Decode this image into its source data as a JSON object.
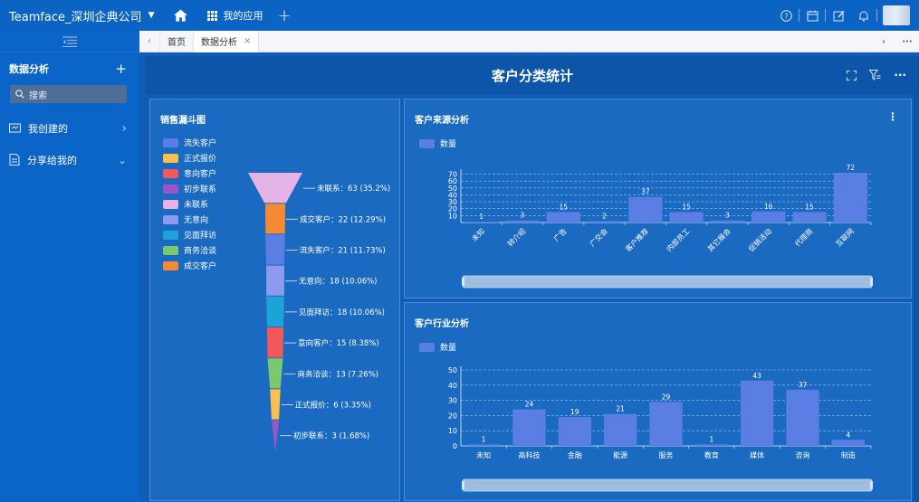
{
  "topbar": {
    "company": "Teamface_深圳企典公司",
    "apps_label": "我的应用"
  },
  "sidebar": {
    "title": "数据分析",
    "search_placeholder": "搜索",
    "items": [
      {
        "label": "我创建的",
        "icon": "folder-icon",
        "chevron": "›"
      },
      {
        "label": "分享给我的",
        "icon": "share-doc-icon",
        "chevron": "⌄"
      }
    ]
  },
  "tabs": [
    {
      "label": "首页",
      "active": false
    },
    {
      "label": "数据分析",
      "active": true,
      "closable": true
    }
  ],
  "dashboard": {
    "title": "客户分类统计"
  },
  "funnel": {
    "title": "销售漏斗图",
    "legend": [
      {
        "label": "流失客户",
        "color": "#5b7ee5"
      },
      {
        "label": "正式报价",
        "color": "#f8c04f"
      },
      {
        "label": "意向客户",
        "color": "#f25a5a"
      },
      {
        "label": "初步联系",
        "color": "#9a55c9"
      },
      {
        "label": "未联系",
        "color": "#e6b3e6"
      },
      {
        "label": "无意向",
        "color": "#8c9af0"
      },
      {
        "label": "见面拜访",
        "color": "#1ea3d6"
      },
      {
        "label": "商务洽谈",
        "color": "#7bc96f"
      },
      {
        "label": "成交客户",
        "color": "#f58a33"
      }
    ]
  },
  "chart_data": [
    {
      "type": "funnel",
      "title": "销售漏斗图",
      "stages": [
        {
          "name": "未联系",
          "value": 63,
          "percent": "35.2%",
          "label": "未联系：63 (35.2%)",
          "color": "#e6b3e6"
        },
        {
          "name": "成交客户",
          "value": 22,
          "percent": "12.29%",
          "label": "成交客户：22 (12.29%)",
          "color": "#f58a33"
        },
        {
          "name": "流失客户",
          "value": 21,
          "percent": "11.73%",
          "label": "流失客户：21 (11.73%)",
          "color": "#5b7ee5"
        },
        {
          "name": "无意向",
          "value": 18,
          "percent": "10.06%",
          "label": "无意向：18 (10.06%)",
          "color": "#8c9af0"
        },
        {
          "name": "见面拜访",
          "value": 18,
          "percent": "10.06%",
          "label": "见面拜访：18 (10.06%)",
          "color": "#1ea3d6"
        },
        {
          "name": "意向客户",
          "value": 15,
          "percent": "8.38%",
          "label": "意向客户：15 (8.38%)",
          "color": "#f25a5a"
        },
        {
          "name": "商务洽谈",
          "value": 13,
          "percent": "7.26%",
          "label": "商务洽谈：13 (7.26%)",
          "color": "#7bc96f"
        },
        {
          "name": "正式报价",
          "value": 6,
          "percent": "3.35%",
          "label": "正式报价：6 (3.35%)",
          "color": "#f8c04f"
        },
        {
          "name": "初步联系",
          "value": 3,
          "percent": "1.68%",
          "label": "初步联系：3 (1.68%)",
          "color": "#9a55c9"
        }
      ]
    },
    {
      "type": "bar",
      "title": "客户来源分析",
      "legend": "数量",
      "categories": [
        "未知",
        "转介绍",
        "广告",
        "广交会",
        "客户推荐",
        "内部员工",
        "其它展会",
        "促销活动",
        "代理商",
        "互联网"
      ],
      "values": [
        1,
        3,
        15,
        2,
        37,
        15,
        3,
        16,
        15,
        72
      ],
      "yticks": [
        10,
        20,
        30,
        40,
        50,
        60,
        70
      ],
      "ylim": [
        0,
        72
      ],
      "color": "#5b7ee5"
    },
    {
      "type": "bar",
      "title": "客户行业分析",
      "legend": "数量",
      "categories": [
        "未知",
        "高科技",
        "金融",
        "能源",
        "服务",
        "教育",
        "媒体",
        "咨询",
        "制造"
      ],
      "values": [
        1,
        24,
        19,
        21,
        29,
        1,
        43,
        37,
        4
      ],
      "yticks": [
        0,
        10,
        20,
        30,
        40,
        50
      ],
      "ylim": [
        0,
        50
      ],
      "color": "#5b7ee5"
    }
  ]
}
